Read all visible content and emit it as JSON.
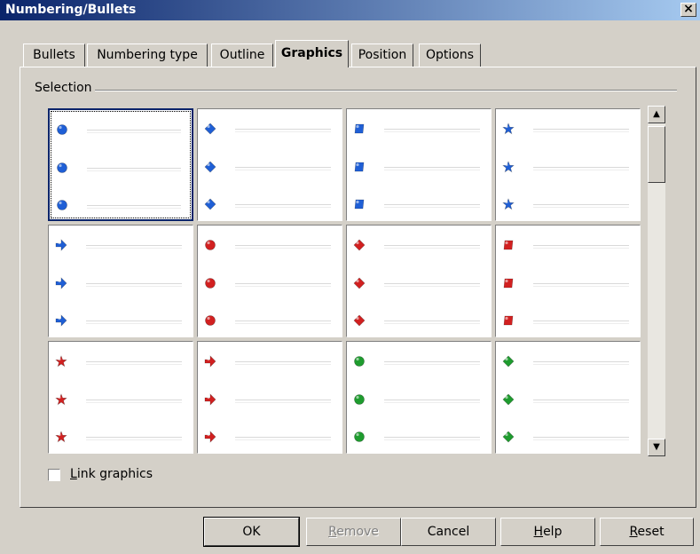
{
  "window": {
    "title": "Numbering/Bullets",
    "close_label": "×"
  },
  "tabs": [
    {
      "label": "Bullets",
      "active": false
    },
    {
      "label": "Numbering type",
      "active": false
    },
    {
      "label": "Outline",
      "active": false
    },
    {
      "label": "Graphics",
      "active": true
    },
    {
      "label": "Position",
      "active": false
    },
    {
      "label": "Options",
      "active": false
    }
  ],
  "selection": {
    "label": "Selection",
    "selected_index": 0,
    "grid": [
      {
        "icon": "blue-sphere-icon",
        "color": "#1f5fd6",
        "shape": "circle"
      },
      {
        "icon": "blue-diamond-icon",
        "color": "#1f5fd6",
        "shape": "diamond"
      },
      {
        "icon": "blue-square-icon",
        "color": "#1f5fd6",
        "shape": "square"
      },
      {
        "icon": "blue-star-icon",
        "color": "#1f5fd6",
        "shape": "star"
      },
      {
        "icon": "blue-arrow-icon",
        "color": "#1f5fd6",
        "shape": "arrow"
      },
      {
        "icon": "red-sphere-icon",
        "color": "#d22020",
        "shape": "circle"
      },
      {
        "icon": "red-diamond-icon",
        "color": "#d22020",
        "shape": "diamond"
      },
      {
        "icon": "red-square-icon",
        "color": "#d22020",
        "shape": "square"
      },
      {
        "icon": "red-star-icon",
        "color": "#d22020",
        "shape": "star"
      },
      {
        "icon": "red-arrow-icon",
        "color": "#d22020",
        "shape": "arrow"
      },
      {
        "icon": "green-sphere-icon",
        "color": "#1e9c2e",
        "shape": "circle"
      },
      {
        "icon": "green-diamond-icon",
        "color": "#1e9c2e",
        "shape": "diamond"
      }
    ]
  },
  "link_graphics": {
    "label_first": "L",
    "label_rest": "ink graphics",
    "checked": false
  },
  "buttons": {
    "ok": "OK",
    "remove_first": "R",
    "remove_rest": "emove",
    "cancel": "Cancel",
    "help_first": "H",
    "help_rest": "elp",
    "reset_first": "R",
    "reset_rest": "eset"
  }
}
